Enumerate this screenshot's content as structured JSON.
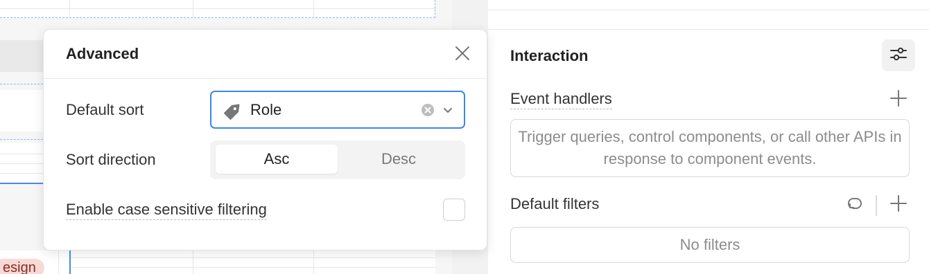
{
  "canvas": {
    "tag_chip": "esign"
  },
  "advanced_popover": {
    "title": "Advanced",
    "close_icon": "close-icon",
    "default_sort": {
      "label": "Default sort",
      "value": "Role",
      "icon": "tag-icon"
    },
    "sort_direction": {
      "label": "Sort direction",
      "options": [
        "Asc",
        "Desc"
      ],
      "selected": "Asc"
    },
    "case_sensitive": {
      "label": "Enable case sensitive filtering",
      "checked": false
    }
  },
  "inspector": {
    "section_title": "Interaction",
    "settings_icon": "sliders-icon",
    "event_handlers": {
      "label": "Event handlers",
      "empty_text": "Trigger queries, control components, or call other APIs in response to component events."
    },
    "default_filters": {
      "label": "Default filters",
      "empty_text": "No filters"
    }
  },
  "colors": {
    "accent": "#3d86e6",
    "tag_chip_bg": "#f9d9d6"
  }
}
